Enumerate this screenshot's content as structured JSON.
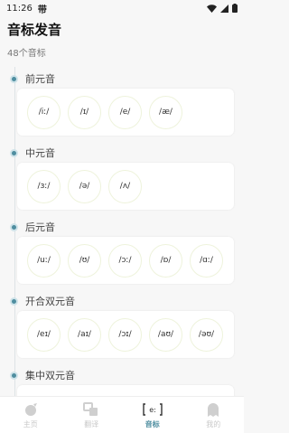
{
  "status": {
    "time": "11:26",
    "app_badge": "带"
  },
  "page": {
    "title": "音标发音",
    "count": "48个音标"
  },
  "sections": [
    {
      "label": "前元音",
      "items": [
        "/iː/",
        "/ɪ/",
        "/e/",
        "/æ/"
      ]
    },
    {
      "label": "中元音",
      "items": [
        "/ɜː/",
        "/ə/",
        "/ʌ/"
      ]
    },
    {
      "label": "后元音",
      "items": [
        "/uː/",
        "/ʊ/",
        "/ɔː/",
        "/ɒ/",
        "/ɑː/"
      ]
    },
    {
      "label": "开合双元音",
      "items": [
        "/eɪ/",
        "/aɪ/",
        "/ɔɪ/",
        "/aʊ/",
        "/əʊ/"
      ]
    },
    {
      "label": "集中双元音",
      "items": []
    }
  ],
  "tabs": [
    {
      "label": "主页",
      "icon": "home-icon",
      "active": false
    },
    {
      "label": "翻译",
      "icon": "translate-icon",
      "active": false
    },
    {
      "label": "音标",
      "icon": "phonetic-icon",
      "active": true
    },
    {
      "label": "我的",
      "icon": "profile-icon",
      "active": false
    }
  ],
  "colors": {
    "accent": "#4f8ea0",
    "inactive": "#c9c9c9"
  }
}
